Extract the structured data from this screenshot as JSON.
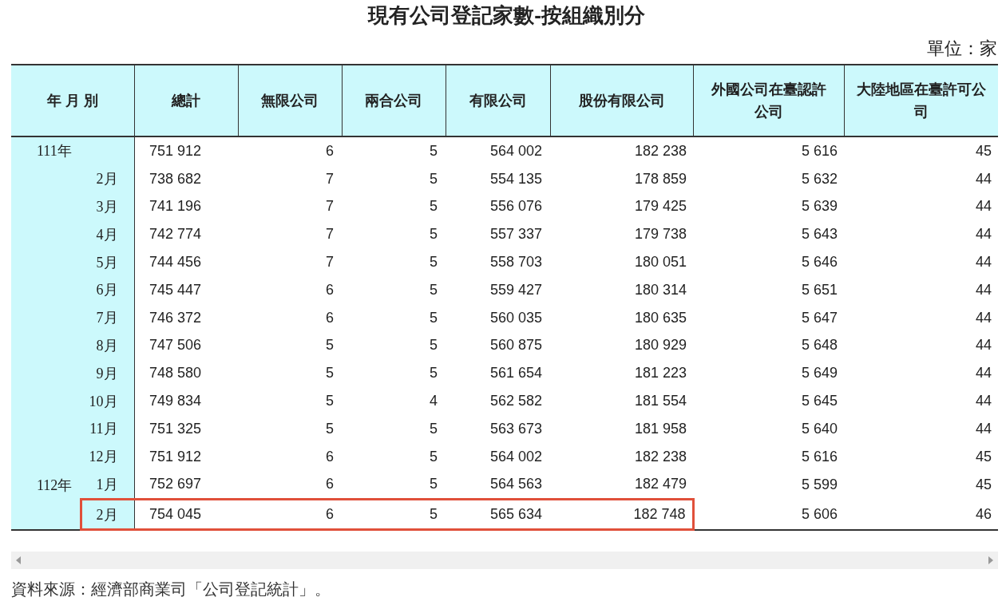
{
  "title": "現有公司登記家數-按組織別分",
  "unit": "單位：家",
  "table": {
    "columns": [
      "年 月 別",
      "總計",
      "無限公司",
      "兩合公司",
      "有限公司",
      "股份有限公司",
      "外國公司在臺認許公司",
      "大陸地區在臺許可公司"
    ],
    "rows": [
      {
        "year": "111年",
        "values": [
          "751 912",
          "6",
          "5",
          "564 002",
          "182 238",
          "5 616",
          "45"
        ],
        "highlighted": false
      },
      {
        "month": "2月",
        "values": [
          "738 682",
          "7",
          "5",
          "554 135",
          "178 859",
          "5 632",
          "44"
        ],
        "highlighted": false
      },
      {
        "month": "3月",
        "values": [
          "741 196",
          "7",
          "5",
          "556 076",
          "179 425",
          "5 639",
          "44"
        ],
        "highlighted": false
      },
      {
        "month": "4月",
        "values": [
          "742 774",
          "7",
          "5",
          "557 337",
          "179 738",
          "5 643",
          "44"
        ],
        "highlighted": false
      },
      {
        "month": "5月",
        "values": [
          "744 456",
          "7",
          "5",
          "558 703",
          "180 051",
          "5 646",
          "44"
        ],
        "highlighted": false
      },
      {
        "month": "6月",
        "values": [
          "745 447",
          "6",
          "5",
          "559 427",
          "180 314",
          "5 651",
          "44"
        ],
        "highlighted": false
      },
      {
        "month": "7月",
        "values": [
          "746 372",
          "6",
          "5",
          "560 035",
          "180 635",
          "5 647",
          "44"
        ],
        "highlighted": false
      },
      {
        "month": "8月",
        "values": [
          "747 506",
          "5",
          "5",
          "560 875",
          "180 929",
          "5 648",
          "44"
        ],
        "highlighted": false
      },
      {
        "month": "9月",
        "values": [
          "748 580",
          "5",
          "5",
          "561 654",
          "181 223",
          "5 649",
          "44"
        ],
        "highlighted": false
      },
      {
        "month": "10月",
        "values": [
          "749 834",
          "5",
          "4",
          "562 582",
          "181 554",
          "5 645",
          "44"
        ],
        "highlighted": false
      },
      {
        "month": "11月",
        "values": [
          "751 325",
          "5",
          "5",
          "563 673",
          "181 958",
          "5 640",
          "44"
        ],
        "highlighted": false
      },
      {
        "month": "12月",
        "values": [
          "751 912",
          "6",
          "5",
          "564 002",
          "182 238",
          "5 616",
          "45"
        ],
        "highlighted": false
      },
      {
        "year": "112年",
        "month": "1月",
        "values": [
          "752 697",
          "6",
          "5",
          "564 563",
          "182 479",
          "5 599",
          "45"
        ],
        "highlighted": false
      },
      {
        "month": "2月",
        "values": [
          "754 045",
          "6",
          "5",
          "565 634",
          "182 748",
          "5 606",
          "46"
        ],
        "highlighted": true
      }
    ]
  },
  "source": "資料來源：經濟部商業司「公司登記統計」。"
}
